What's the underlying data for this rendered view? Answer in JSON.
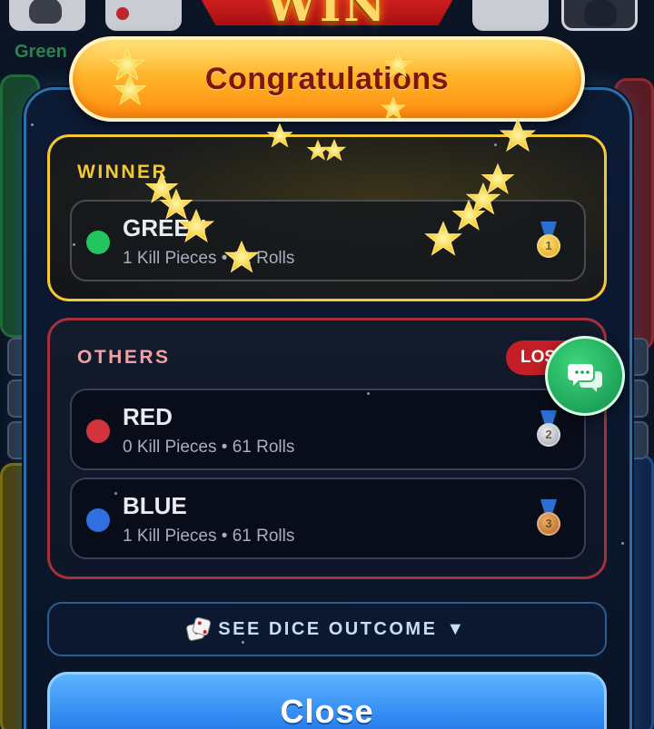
{
  "background": {
    "player_name": "Green"
  },
  "banner": {
    "win_text": "WIN"
  },
  "header": {
    "title": "Congratulations"
  },
  "winner": {
    "section_label": "WINNER",
    "player": {
      "name": "GREEN",
      "color": "#22c55e",
      "stats": "1 Kill Pieces • 61 Rolls",
      "medal": "gold-medal-1st"
    }
  },
  "others": {
    "section_label": "OTHERS",
    "badge": "LOSE",
    "players": [
      {
        "name": "RED",
        "color": "#d2343f",
        "stats": "0 Kill Pieces • 61 Rolls",
        "medal": "silver-medal-2nd",
        "rank": "2"
      },
      {
        "name": "BLUE",
        "color": "#2f6fe0",
        "stats": "1 Kill Pieces • 61 Rolls",
        "medal": "bronze-medal-3rd",
        "rank": "3"
      }
    ]
  },
  "actions": {
    "dice_outcome_label": "SEE DICE OUTCOME",
    "dice_toggle_glyph": "▼",
    "close_label": "Close"
  },
  "icons": {
    "dice": "dice-icon",
    "chat": "chat-bubbles-icon",
    "chevron": "triangle-down-icon"
  },
  "colors": {
    "winner_border": "#f5c832",
    "others_border": "#a6303a",
    "close_button": "#2f86f0",
    "header_pill": "#ffb52a",
    "chat_button": "#1ea45a"
  }
}
